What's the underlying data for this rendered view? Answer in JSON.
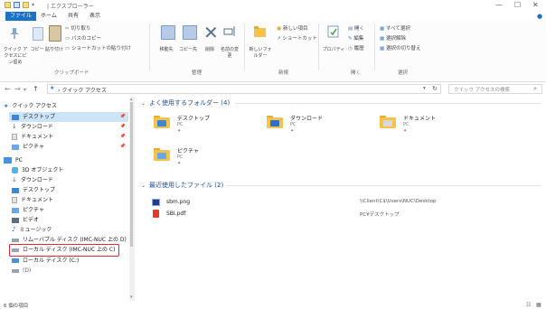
{
  "window": {
    "title": "| エクスプローラー",
    "minimize": "—",
    "maximize": "☐",
    "close": "✕"
  },
  "ribbon_tabs": [
    "ファイル",
    "ホーム",
    "共有",
    "表示"
  ],
  "ribbon": {
    "clipboard": {
      "quick_access": "クイック アクセスにピン留め",
      "copy": "コピー",
      "paste": "貼り付け",
      "cut": "切り取り",
      "copy_path": "パスのコピー",
      "paste_shortcut": "ショートカットの貼り付け",
      "group": "クリップボード"
    },
    "organize": {
      "move": "移動先",
      "copy_to": "コピー先",
      "delete": "削除",
      "rename": "名前の変更",
      "group": "整理"
    },
    "new": {
      "new_folder": "新しいフォルダー",
      "new_item": "新しい項目",
      "easy_access": "ショートカット",
      "group": "新規"
    },
    "open": {
      "properties": "プロパティ",
      "open": "開く",
      "edit": "編集",
      "history": "履歴",
      "group": "開く"
    },
    "select": {
      "select_all": "すべて選択",
      "select_none": "選択解除",
      "invert": "選択の切り替え",
      "group": "選択"
    }
  },
  "address": {
    "path": "クイック アクセス",
    "search_placeholder": "クイック アクセスの検索"
  },
  "nav": {
    "quick_access": "クイック アクセス",
    "items": [
      {
        "label": "デスクトップ",
        "pinned": true,
        "icon": "desktop"
      },
      {
        "label": "ダウンロード",
        "pinned": true,
        "icon": "download"
      },
      {
        "label": "ドキュメント",
        "pinned": true,
        "icon": "document"
      },
      {
        "label": "ピクチャ",
        "pinned": true,
        "icon": "picture"
      }
    ],
    "pc": "PC",
    "pc_items": [
      {
        "label": "3D オブジェクト",
        "icon": "3d"
      },
      {
        "label": "ダウンロード",
        "icon": "download"
      },
      {
        "label": "デスクトップ",
        "icon": "desktop"
      },
      {
        "label": "ドキュメント",
        "icon": "document"
      },
      {
        "label": "ピクチャ",
        "icon": "picture"
      },
      {
        "label": "ビデオ",
        "icon": "video"
      },
      {
        "label": "ミュージック",
        "icon": "music"
      },
      {
        "label": "リムーバブル ディスク (IMC-NUC 上の D)",
        "icon": "drive"
      },
      {
        "label": "ローカル ディスク (IMC-NUC 上の C)",
        "icon": "drive",
        "highlighted": true
      },
      {
        "label": "ローカル ディスク (C:)",
        "icon": "drive"
      },
      {
        "label": "(D)",
        "icon": "drive"
      }
    ]
  },
  "frequent": {
    "header": "よく使用するフォルダー (4)",
    "folders": [
      {
        "name": "デスクトップ",
        "location": "PC",
        "badge_color": "#3b86d9"
      },
      {
        "name": "ダウンロード",
        "location": "PC",
        "badge_color": "#2a6fd1"
      },
      {
        "name": "ドキュメント",
        "location": "PC",
        "badge_color": "#d9d9d9"
      },
      {
        "name": "ピクチャ",
        "location": "PC",
        "badge_color": "#6aa6e8"
      }
    ]
  },
  "recent": {
    "header": "最近使用したファイル (2)",
    "files": [
      {
        "name": "sbm.png",
        "path": "\\\\Client\\C$\\Users\\NUC\\Desktop",
        "icon": "png"
      },
      {
        "name": "SBI.pdf",
        "path": "PC¥デスクトップ",
        "icon": "pdf"
      }
    ]
  },
  "status": {
    "item_count": "6 個の項目"
  },
  "colors": {
    "accent": "#1a73c7",
    "highlight": "#e0283c",
    "section_header": "#1e4e9c"
  }
}
